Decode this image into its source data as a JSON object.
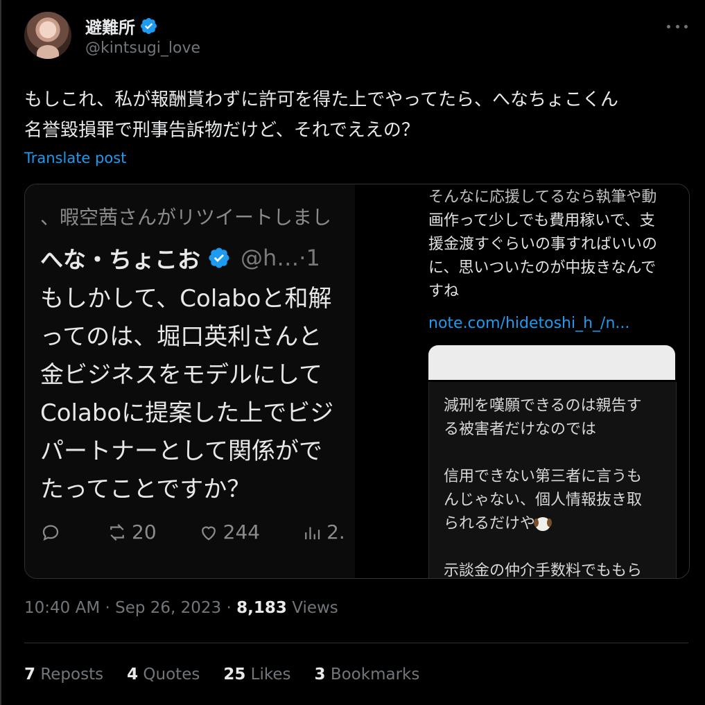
{
  "author": {
    "display_name": "避難所",
    "handle": "@kintsugi_love"
  },
  "tweet": {
    "text_lines": [
      "もしこれ、私が報酬貰わずに許可を得た上でやってたら、へなちょこくん",
      "名誉毀損罪で刑事告訴物だけど、それでええの？"
    ],
    "translate_label": "Translate post"
  },
  "media": {
    "left": {
      "retweet_line": "、暇空茜さんがリツイートしまし",
      "author_name": "へな・ちょこお",
      "author_handle": "@h…·1",
      "body_lines": [
        "もしかして、Colaboと和解",
        "ってのは、堀口英利さんと",
        "金ビジネスをモデルにして",
        "Colaboに提案した上でビジ",
        "パートナーとして関係がで",
        "たってことですか？"
      ],
      "retweets": "20",
      "likes": "244",
      "views": "2."
    },
    "top_right": {
      "body_lines": [
        "そんなに応援してるなら執筆や動",
        "画作って少しでも費用稼いで、支",
        "援金渡すぐらいの事すればいいの",
        "に、思いついたのが中抜きなんで",
        "すね"
      ],
      "link": "note.com/hidetoshi_h_/n..."
    },
    "bottom_right": {
      "body_lines": [
        "減刑を嘆願できるのは親告す",
        "る被害者だけなのでは",
        "",
        "信用できない第三者に言うも",
        "んじゃない、個人情報抜き取",
        "られるだけや",
        "",
        "示談金の仲介手数料でももら"
      ]
    }
  },
  "meta": {
    "time": "10:40 AM",
    "date": "Sep 26, 2023",
    "views_count": "8,183",
    "views_label": "Views"
  },
  "stats": {
    "reposts_count": "7",
    "reposts_label": "Reposts",
    "quotes_count": "4",
    "quotes_label": "Quotes",
    "likes_count": "25",
    "likes_label": "Likes",
    "bookmarks_count": "3",
    "bookmarks_label": "Bookmarks"
  },
  "colors": {
    "background": "#000000",
    "text": "#e7e9ea",
    "secondary": "#71767b",
    "accent": "#1d9bf0",
    "border": "#2f3336"
  },
  "icons": [
    "verified-badge-icon",
    "more-options-icon",
    "reply-icon",
    "retweet-icon",
    "like-icon",
    "views-icon",
    "dog-emoji-icon"
  ]
}
